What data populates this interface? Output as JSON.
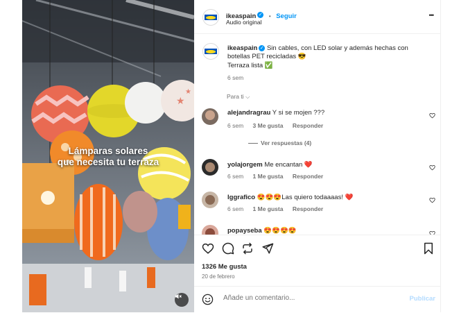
{
  "media": {
    "overlay_line1": "Lámparas solares",
    "overlay_line2": "que necesita tu terraza"
  },
  "header": {
    "username": "ikeaspain",
    "separator": "•",
    "follow_label": "Seguir",
    "audio_label": "Audio original",
    "more_label": "•••"
  },
  "caption": {
    "username": "ikeaspain",
    "text": "Sin cables, con LED solar y además hechas con botellas PET recicladas 😎",
    "text2": "Terraza lista ✅",
    "time": "6 sem"
  },
  "filter": {
    "label": "Para ti"
  },
  "comments": [
    {
      "username": "alejandragrau",
      "text": "Y si se mojen ???",
      "time": "6 sem",
      "likes": "3 Me gusta",
      "reply": "Responder",
      "view_replies": "Ver respuestas (4)"
    },
    {
      "username": "yolajorgem",
      "text": "Me encantan ❤️",
      "time": "6 sem",
      "likes": "1 Me gusta",
      "reply": "Responder"
    },
    {
      "username": "lggrafico",
      "text": "😍😍😍Las quiero todaaaas! ❤️",
      "time": "6 sem",
      "likes": "1 Me gusta",
      "reply": "Responder"
    },
    {
      "username": "popayseba",
      "text": "😍😍😍😍"
    }
  ],
  "actions": {
    "likes_text": "1326 Me gusta",
    "date": "20 de febrero"
  },
  "add_comment": {
    "placeholder": "Añade un comentario...",
    "publish_label": "Publicar"
  },
  "colors": {
    "accent": "#0095f6",
    "publish_disabled": "#b3dbff",
    "meta_gray": "#737373",
    "like_red": "#ed4956"
  },
  "icons": [
    "verified-badge-icon",
    "more-options-icon",
    "heart-icon",
    "comment-icon",
    "share-icon",
    "repost-icon",
    "bookmark-icon",
    "emoji-icon",
    "mute-icon",
    "chevron-down-icon"
  ]
}
